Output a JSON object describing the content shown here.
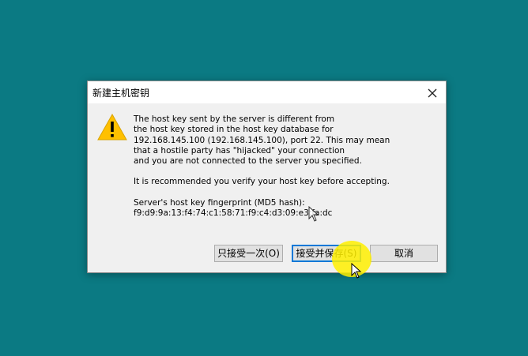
{
  "dialog": {
    "title": "新建主机密钥",
    "close_icon": "close-icon",
    "warning_icon": "warning-icon",
    "message": {
      "paragraph1": "The host key sent by the server is different from\nthe host key stored in the host key database for\n192.168.145.100 (192.168.145.100), port 22.  This may mean\nthat a hostile party has \"hijacked\" your connection\nand you are not connected to the server you specified.",
      "paragraph2": "It is recommended you verify your host key before accepting.",
      "paragraph3": "Server's host key fingerprint (MD5 hash):\nf9:d9:9a:13:f4:74:c1:58:71:f9:c4:d3:09:e3:fa:dc"
    },
    "buttons": {
      "accept_once": "只接受一次(O)",
      "accept_save": "接受并保存(S)",
      "cancel": "取消"
    }
  },
  "colors": {
    "desktop": "#0b7a83",
    "dialog_bg": "#f0f0f0",
    "focus_border": "#0078d7",
    "click_highlight": "#fff000",
    "warning": "#ffc000"
  }
}
